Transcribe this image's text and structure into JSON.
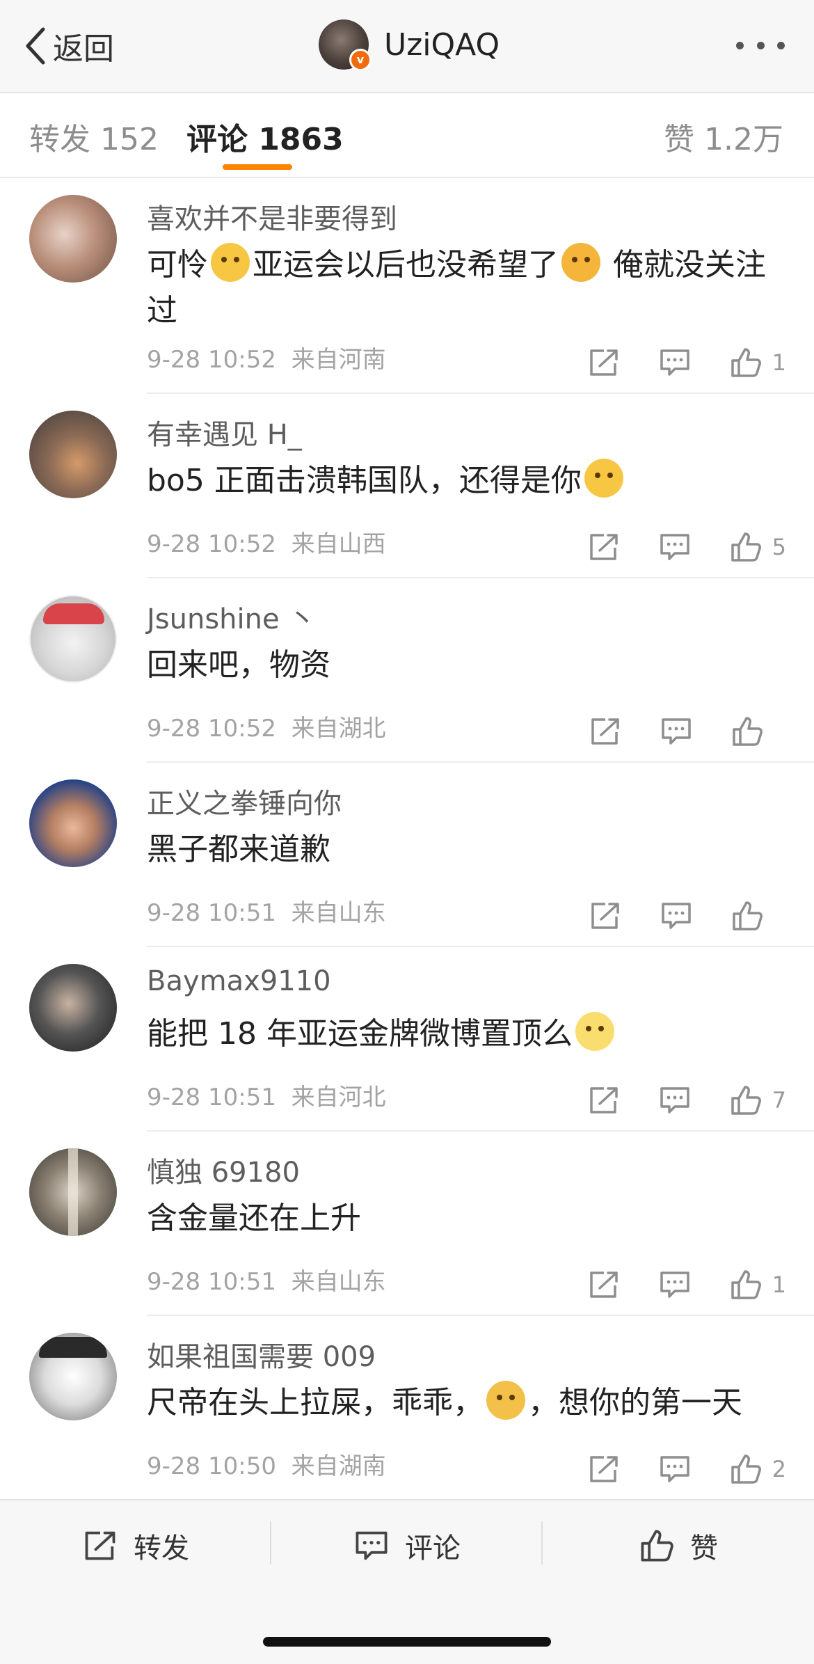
{
  "header": {
    "back_label": "返回",
    "title": "UziQAQ",
    "verified_badge": "v"
  },
  "tabs": {
    "repost": "转发 152",
    "comment": "评论 1863",
    "like": "赞 1.2万"
  },
  "colors": {
    "accent": "#ff8200",
    "badge": "#f26b0e",
    "emoji": "#f7c744"
  },
  "comments": [
    {
      "user": "喜欢并不是非要得到",
      "text_a": "可怜",
      "text_b": "亚运会以后也没希望了",
      "text_c": " 俺就没关注过",
      "time": "9-28 10:52",
      "source": "来自河南",
      "likes": "1"
    },
    {
      "user": "有幸遇见 H_",
      "text_a": "bo5 正面击溃韩国队，还得是你",
      "time": "9-28 10:52",
      "source": "来自山西",
      "likes": "5"
    },
    {
      "user": "Jsunshine 丶",
      "text_a": "回来吧，物资",
      "time": "9-28 10:52",
      "source": "来自湖北",
      "likes": ""
    },
    {
      "user": "正义之拳锤向你",
      "text_a": "黑子都来道歉",
      "time": "9-28 10:51",
      "source": "来自山东",
      "likes": ""
    },
    {
      "user": "Baymax9110",
      "text_a": "能把 18 年亚运金牌微博置顶么",
      "time": "9-28 10:51",
      "source": "来自河北",
      "likes": "7"
    },
    {
      "user": "慎独 69180",
      "text_a": "含金量还在上升",
      "time": "9-28 10:51",
      "source": "来自山东",
      "likes": "1"
    },
    {
      "user": "如果祖国需要 009",
      "text_a": "尺帝在头上拉屎，乖乖，",
      "text_b": "，想你的第一天",
      "time": "9-28 10:50",
      "source": "来自湖南",
      "likes": "2"
    }
  ],
  "bottom": {
    "repost": "转发",
    "comment": "评论",
    "like": "赞"
  }
}
